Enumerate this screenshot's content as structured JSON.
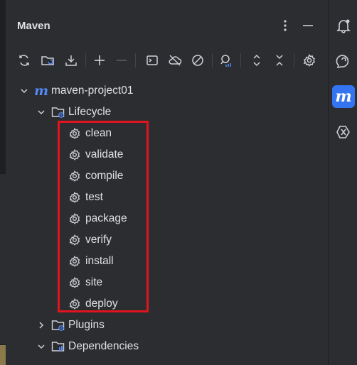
{
  "panel": {
    "title": "Maven",
    "menu_icon": "more-vertical-icon",
    "minimize_icon": "minimize-icon"
  },
  "toolbar": {
    "buttons": [
      {
        "name": "reload-all-projects-icon"
      },
      {
        "name": "generate-sources-icon"
      },
      {
        "name": "download-sources-icon"
      },
      {
        "name": "add-project-icon"
      },
      {
        "name": "remove-project-icon"
      },
      {
        "name": "execute-goal-icon"
      },
      {
        "name": "toggle-offline-icon"
      },
      {
        "name": "skip-tests-icon"
      },
      {
        "name": "analyze-dependencies-icon"
      },
      {
        "name": "expand-all-icon"
      },
      {
        "name": "collapse-all-icon"
      },
      {
        "name": "settings-icon"
      }
    ]
  },
  "tree": {
    "project": {
      "label": "maven-project01",
      "expanded": true
    },
    "lifecycle": {
      "label": "Lifecycle",
      "expanded": true,
      "goals": [
        "clean",
        "validate",
        "compile",
        "test",
        "package",
        "verify",
        "install",
        "site",
        "deploy"
      ]
    },
    "plugins": {
      "label": "Plugins",
      "expanded": false
    },
    "dependencies": {
      "label": "Dependencies",
      "expanded": true
    }
  },
  "right_bar": {
    "items": [
      {
        "name": "notifications-icon",
        "active": false
      },
      {
        "name": "ai-assistant-icon",
        "active": false
      },
      {
        "name": "maven-tool-window-icon",
        "active": true,
        "glyph": "m"
      },
      {
        "name": "plugin-tool-icon",
        "active": false
      }
    ]
  },
  "colors": {
    "background": "#2b2d30",
    "text": "#dfe1e5",
    "icon": "#ced0d6",
    "accent": "#3574f0",
    "maven_m": "#548af7",
    "highlight_border": "#e0141e"
  }
}
